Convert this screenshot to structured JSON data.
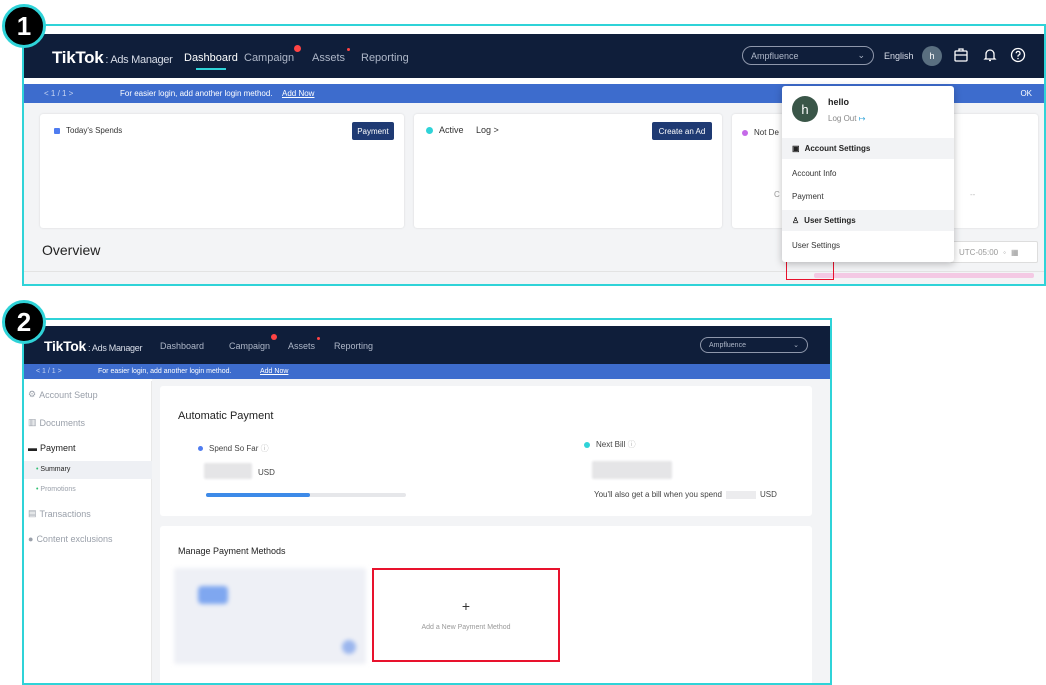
{
  "steps": {
    "first": "1",
    "second": "2"
  },
  "topbar": {
    "logo": "TikTok",
    "logo_suffix": ": Ads Manager",
    "nav": [
      "Dashboard",
      "Campaign",
      "Assets",
      "Reporting"
    ],
    "account_select": "Ampfluence",
    "language": "English",
    "avatar_letter": "h"
  },
  "banner": {
    "pager": "<   1  /  1   >",
    "message": "For easier login, add another login method.",
    "link": "Add Now",
    "ok": "OK"
  },
  "dashboard": {
    "spend_card_title": "Today's Spends",
    "payment_button": "Payment",
    "active_label": "Active",
    "log_link": "Log >",
    "create_ad_button": "Create an Ad",
    "third_card_label": "Not De",
    "overview_title": "Overview",
    "timezone": "UTC-05:00",
    "placeholder_dash": "--"
  },
  "dropdown": {
    "username": "hello",
    "logout": "Log Out",
    "account_settings_header": "Account Settings",
    "account_info": "Account Info",
    "payment": "Payment",
    "user_settings_header": "User Settings",
    "user_settings": "User Settings"
  },
  "sidebar": {
    "account_setup": "Account Setup",
    "documents": "Documents",
    "payment": "Payment",
    "summary": "Summary",
    "promotions": "Promotions",
    "transactions": "Transactions",
    "content_exclusions": "Content exclusions"
  },
  "payment_page": {
    "automatic_payment": "Automatic Payment",
    "spend_so_far": "Spend So Far",
    "spend_currency": "USD",
    "spend_progress": 0.52,
    "next_bill": "Next Bill",
    "bill_note_pre": "You'll also get a bill when you spend",
    "bill_note_currency": "USD",
    "manage_methods": "Manage Payment Methods",
    "add_method_plus": "+",
    "add_method": "Add a New Payment Method"
  },
  "colors": {
    "highlight": "#2fd3d8",
    "nav_bg": "#0f1e3a",
    "banner": "#3d6ccd",
    "annotation_red": "#e8122d"
  }
}
